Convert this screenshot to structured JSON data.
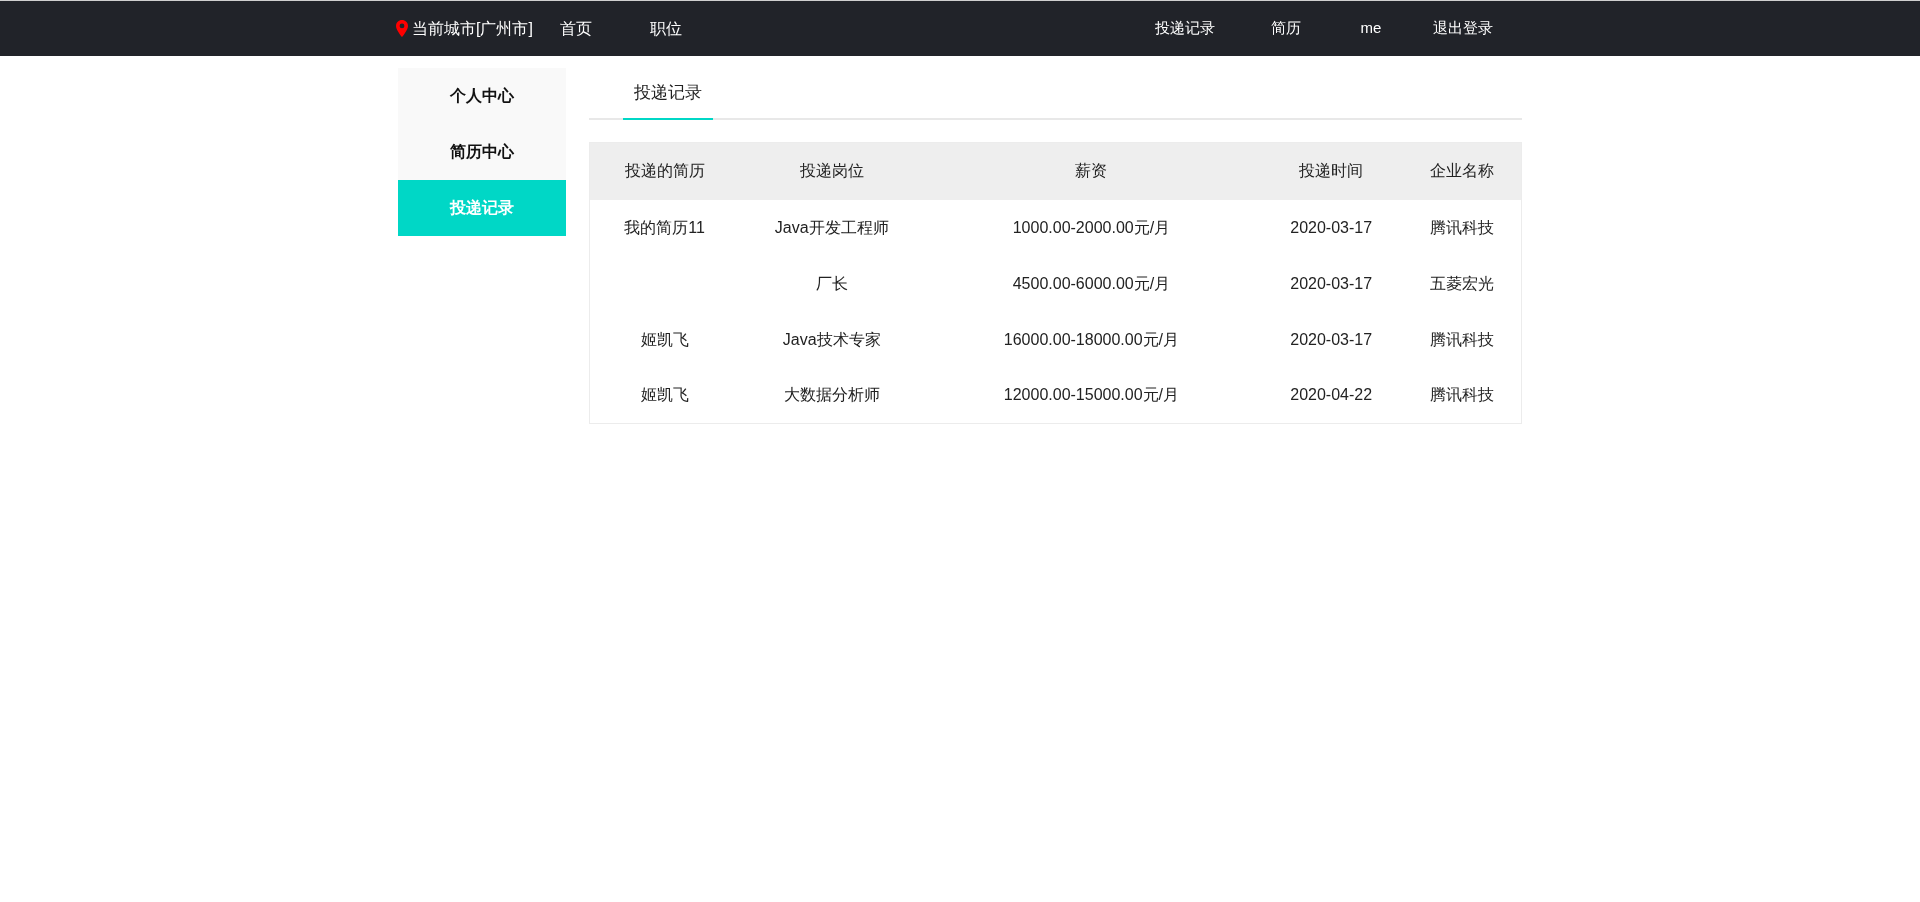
{
  "navbar": {
    "city": "当前城市[广州市]",
    "left_links": [
      "首页",
      "职位"
    ],
    "right_links": [
      "投递记录",
      "简历",
      "me",
      "退出登录"
    ]
  },
  "sidebar": {
    "items": [
      {
        "label": "个人中心",
        "selected": false
      },
      {
        "label": "简历中心",
        "selected": false
      },
      {
        "label": "投递记录",
        "selected": true
      }
    ]
  },
  "tabs": [
    {
      "label": "投递记录",
      "selected": true
    }
  ],
  "table": {
    "columns": [
      "投递的简历",
      "投递岗位",
      "薪资",
      "投递时间",
      "企业名称"
    ],
    "rows": [
      [
        "我的简历11",
        "Java开发工程师",
        "1000.00-2000.00元/月",
        "2020-03-17",
        "腾讯科技"
      ],
      [
        "",
        "厂长",
        "4500.00-6000.00元/月",
        "2020-03-17",
        "五菱宏光"
      ],
      [
        "姬凯飞",
        "Java技术专家",
        "16000.00-18000.00元/月",
        "2020-03-17",
        "腾讯科技"
      ],
      [
        "姬凯飞",
        "大数据分析师",
        "12000.00-15000.00元/月",
        "2020-04-22",
        "腾讯科技"
      ]
    ]
  }
}
